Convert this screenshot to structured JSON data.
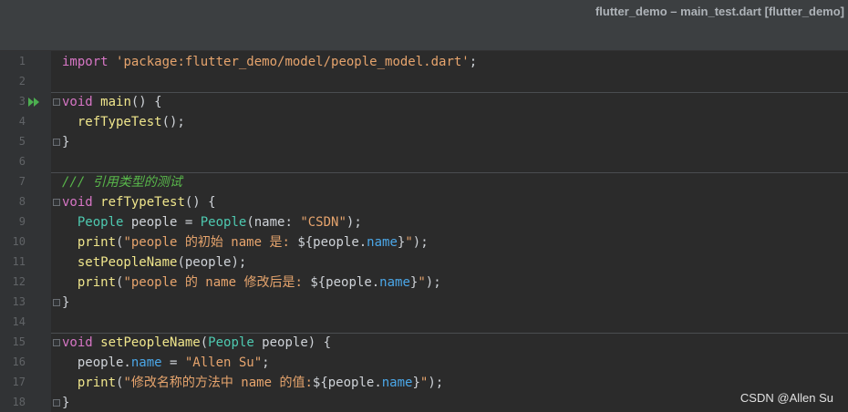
{
  "window": {
    "title": "flutter_demo – main_test.dart [flutter_demo]"
  },
  "watermark": "CSDN @Allen Su",
  "icons": {
    "run": "run-icon",
    "fold": "fold-marker-icon"
  },
  "colors": {
    "keyword": "#d776c5",
    "string": "#e6a46d",
    "type": "#4ec9b0",
    "function": "#f0e68c",
    "property": "#4ba7e8",
    "comment": "#59b84b"
  },
  "lines": [
    {
      "n": "1",
      "tokens": [
        [
          "kw",
          "import"
        ],
        [
          "pn",
          " "
        ],
        [
          "str",
          "'package:flutter_demo/model/people_model.dart'"
        ],
        [
          "pn",
          ";"
        ]
      ]
    },
    {
      "n": "2",
      "tokens": []
    },
    {
      "n": "3",
      "tokens": [
        [
          "kw",
          "void"
        ],
        [
          "pn",
          " "
        ],
        [
          "fn",
          "main"
        ],
        [
          "pn",
          "() {"
        ]
      ]
    },
    {
      "n": "4",
      "tokens": [
        [
          "pn",
          "  "
        ],
        [
          "fn",
          "refTypeTest"
        ],
        [
          "pn",
          "();"
        ]
      ]
    },
    {
      "n": "5",
      "tokens": [
        [
          "pn",
          "}"
        ]
      ]
    },
    {
      "n": "6",
      "tokens": []
    },
    {
      "n": "7",
      "tokens": [
        [
          "cmt",
          "/// 引用类型的测试"
        ]
      ]
    },
    {
      "n": "8",
      "tokens": [
        [
          "kw",
          "void"
        ],
        [
          "pn",
          " "
        ],
        [
          "fn",
          "refTypeTest"
        ],
        [
          "pn",
          "() {"
        ]
      ]
    },
    {
      "n": "9",
      "tokens": [
        [
          "pn",
          "  "
        ],
        [
          "typ",
          "People"
        ],
        [
          "pn",
          " people = "
        ],
        [
          "typ",
          "People"
        ],
        [
          "pn",
          "(name: "
        ],
        [
          "str",
          "\"CSDN\""
        ],
        [
          "pn",
          ");"
        ]
      ]
    },
    {
      "n": "10",
      "tokens": [
        [
          "pn",
          "  "
        ],
        [
          "fn",
          "print"
        ],
        [
          "pn",
          "("
        ],
        [
          "str",
          "\"people 的初始 name 是: "
        ],
        [
          "pn",
          "${people."
        ],
        [
          "prop",
          "name"
        ],
        [
          "pn",
          "}"
        ],
        [
          "str",
          "\""
        ],
        [
          "pn",
          ");"
        ]
      ]
    },
    {
      "n": "11",
      "tokens": [
        [
          "pn",
          "  "
        ],
        [
          "fn",
          "setPeopleName"
        ],
        [
          "pn",
          "(people);"
        ]
      ]
    },
    {
      "n": "12",
      "tokens": [
        [
          "pn",
          "  "
        ],
        [
          "fn",
          "print"
        ],
        [
          "pn",
          "("
        ],
        [
          "str",
          "\"people 的 name 修改后是: "
        ],
        [
          "pn",
          "${people."
        ],
        [
          "prop",
          "name"
        ],
        [
          "pn",
          "}"
        ],
        [
          "str",
          "\""
        ],
        [
          "pn",
          ");"
        ]
      ]
    },
    {
      "n": "13",
      "tokens": [
        [
          "pn",
          "}"
        ]
      ]
    },
    {
      "n": "14",
      "tokens": []
    },
    {
      "n": "15",
      "tokens": [
        [
          "kw",
          "void"
        ],
        [
          "pn",
          " "
        ],
        [
          "fn",
          "setPeopleName"
        ],
        [
          "pn",
          "("
        ],
        [
          "typ",
          "People"
        ],
        [
          "pn",
          " people) {"
        ]
      ]
    },
    {
      "n": "16",
      "tokens": [
        [
          "pn",
          "  people."
        ],
        [
          "prop",
          "name"
        ],
        [
          "pn",
          " = "
        ],
        [
          "str",
          "\"Allen Su\""
        ],
        [
          "pn",
          ";"
        ]
      ]
    },
    {
      "n": "17",
      "tokens": [
        [
          "pn",
          "  "
        ],
        [
          "fn",
          "print"
        ],
        [
          "pn",
          "("
        ],
        [
          "str",
          "\"修改名称的方法中 name 的值:"
        ],
        [
          "pn",
          "${people."
        ],
        [
          "prop",
          "name"
        ],
        [
          "pn",
          "}"
        ],
        [
          "str",
          "\""
        ],
        [
          "pn",
          ");"
        ]
      ]
    },
    {
      "n": "18",
      "tokens": [
        [
          "pn",
          "}"
        ]
      ]
    }
  ]
}
